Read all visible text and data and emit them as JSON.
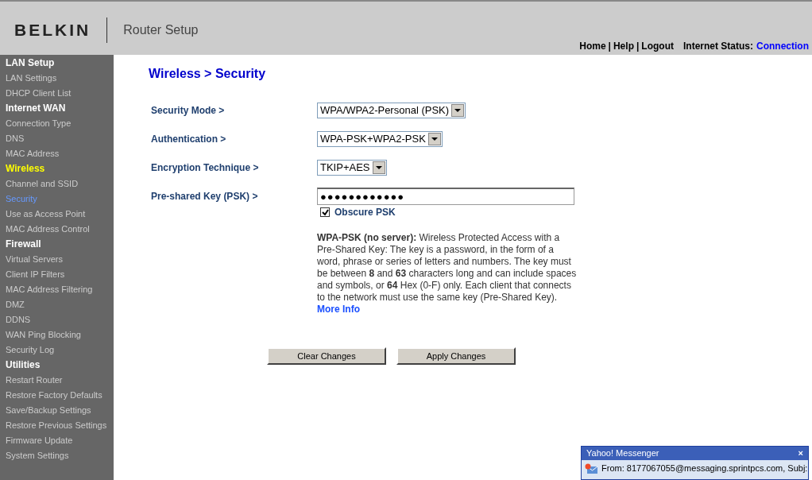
{
  "header": {
    "logo": "BELKIN",
    "title": "Router Setup",
    "nav": [
      {
        "label": "Home"
      },
      {
        "label": "Help"
      },
      {
        "label": "Logout"
      }
    ],
    "separator": "|",
    "status_label": "Internet Status:",
    "status_value": "Connection"
  },
  "sidebar": {
    "groups": [
      {
        "label": "LAN Setup",
        "selected": false,
        "items": [
          {
            "label": "LAN Settings",
            "selected": false
          },
          {
            "label": "DHCP Client List",
            "selected": false
          }
        ]
      },
      {
        "label": "Internet WAN",
        "selected": false,
        "items": [
          {
            "label": "Connection Type",
            "selected": false
          },
          {
            "label": "DNS",
            "selected": false
          },
          {
            "label": "MAC Address",
            "selected": false
          }
        ]
      },
      {
        "label": "Wireless",
        "selected": true,
        "items": [
          {
            "label": "Channel and SSID",
            "selected": false
          },
          {
            "label": "Security",
            "selected": true
          },
          {
            "label": "Use as Access Point",
            "selected": false
          },
          {
            "label": "MAC Address Control",
            "selected": false
          }
        ]
      },
      {
        "label": "Firewall",
        "selected": false,
        "items": [
          {
            "label": "Virtual Servers",
            "selected": false
          },
          {
            "label": "Client IP Filters",
            "selected": false
          },
          {
            "label": "MAC Address Filtering",
            "selected": false
          },
          {
            "label": "DMZ",
            "selected": false
          },
          {
            "label": "DDNS",
            "selected": false
          },
          {
            "label": "WAN Ping Blocking",
            "selected": false
          },
          {
            "label": "Security Log",
            "selected": false
          }
        ]
      },
      {
        "label": "Utilities",
        "selected": false,
        "items": [
          {
            "label": "Restart Router",
            "selected": false
          },
          {
            "label": "Restore Factory Defaults",
            "selected": false
          },
          {
            "label": "Save/Backup Settings",
            "selected": false
          },
          {
            "label": "Restore Previous Settings",
            "selected": false
          },
          {
            "label": "Firmware Update",
            "selected": false
          },
          {
            "label": "System Settings",
            "selected": false
          }
        ]
      }
    ]
  },
  "page_title": "Wireless > Security",
  "form": [
    {
      "kind": "select",
      "label": "Security Mode >",
      "value": "WPA/WPA2-Personal (PSK)"
    },
    {
      "kind": "select",
      "label": "Authentication >",
      "value": "WPA-PSK+WPA2-PSK"
    },
    {
      "kind": "select",
      "label": "Encryption Technique >",
      "value": "TKIP+AES"
    },
    {
      "kind": "password",
      "label": "Pre-shared Key (PSK) >",
      "value": "●●●●●●●●●●●●"
    }
  ],
  "obscure": {
    "label": "Obscure PSK",
    "checked": true
  },
  "description": {
    "text": "**WPA-PSK (no server):** Wireless Protected Access with a Pre-Shared Key: The key is a password, in the form of a word, phrase or series of letters and numbers. The key must be between **8** and **63** characters long and can include spaces and symbols, or **64** Hex (0-F) only. Each client that connects to the network must use the same key (Pre-Shared Key).",
    "link": "More Info"
  },
  "buttons": [
    "Clear Changes",
    "Apply Changes"
  ],
  "notification": {
    "title": "Yahoo! Messenger",
    "close": "×",
    "message": "From: 8177067055@messaging.sprintpcs.com, Subj:"
  }
}
